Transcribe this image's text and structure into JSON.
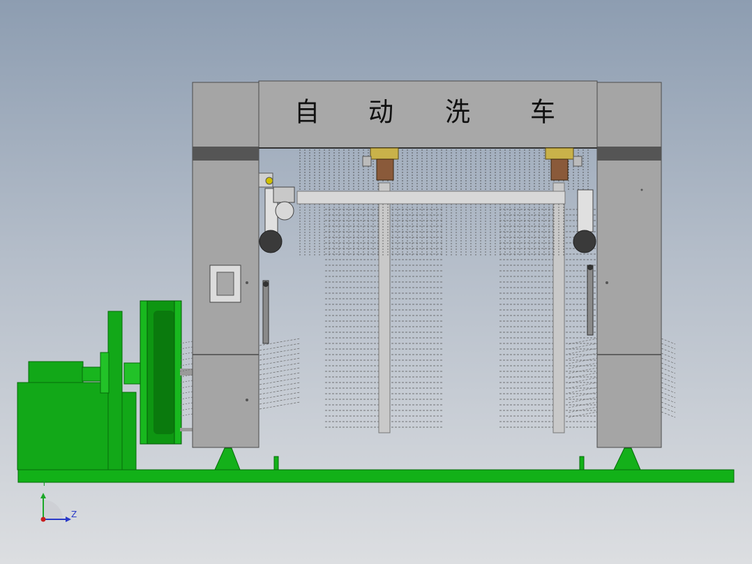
{
  "model": {
    "title_chars": [
      "自",
      "动",
      "洗",
      "车"
    ]
  },
  "triad": {
    "y_label": "Y",
    "z_label": "Z"
  },
  "colors": {
    "frame_gray": "#a4a4a4",
    "green": "#0fae16",
    "dark_band": "#505050",
    "brush_pole": "#c8c8c8",
    "motor_dark": "#404040"
  },
  "icons": {
    "triad": "coordinate-triad-icon"
  }
}
